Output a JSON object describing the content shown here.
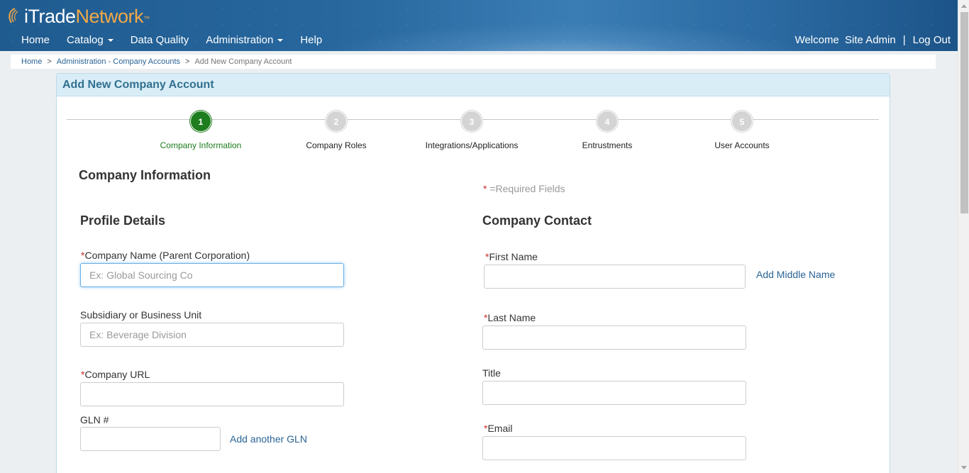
{
  "header": {
    "logo": {
      "i": "i",
      "trade": "Trade",
      "network": "Network",
      "tm": "™"
    },
    "nav": [
      {
        "label": "Home",
        "dropdown": false
      },
      {
        "label": "Catalog",
        "dropdown": true
      },
      {
        "label": "Data Quality",
        "dropdown": false
      },
      {
        "label": "Administration",
        "dropdown": true
      },
      {
        "label": "Help",
        "dropdown": false
      }
    ],
    "welcome": "Welcome",
    "user_name": "Site Admin",
    "separator": "|",
    "logout": "Log Out"
  },
  "breadcrumb": {
    "items": [
      "Home",
      "Administration - Company Accounts"
    ],
    "separator": ">",
    "current": "Add New Company Account"
  },
  "panel": {
    "title": "Add New Company Account"
  },
  "steps": [
    {
      "number": "1",
      "label": "Company Information",
      "active": true
    },
    {
      "number": "2",
      "label": "Company Roles",
      "active": false
    },
    {
      "number": "3",
      "label": "Integrations/Applications",
      "active": false
    },
    {
      "number": "4",
      "label": "Entrustments",
      "active": false
    },
    {
      "number": "5",
      "label": "User Accounts",
      "active": false
    }
  ],
  "form": {
    "section_title": "Company Information",
    "required_star": "*",
    "required_note": " =Required Fields",
    "profile": {
      "title": "Profile Details",
      "company_name": {
        "label": "Company Name (Parent Corporation)",
        "required": true,
        "value": "",
        "placeholder": "Ex: Global Sourcing Co"
      },
      "subsidiary": {
        "label": "Subsidiary or Business Unit",
        "required": false,
        "value": "",
        "placeholder": "Ex: Beverage Division"
      },
      "company_url": {
        "label": "Company URL",
        "required": true,
        "value": "",
        "placeholder": ""
      },
      "gln": {
        "label": "GLN #",
        "required": false,
        "value": "",
        "placeholder": ""
      },
      "add_gln": "Add another GLN"
    },
    "contact": {
      "title": "Company Contact",
      "first_name": {
        "label": "First Name",
        "required": true,
        "value": "",
        "placeholder": ""
      },
      "add_middle_name": "Add Middle Name",
      "last_name": {
        "label": "Last Name",
        "required": true,
        "value": "",
        "placeholder": ""
      },
      "title_field": {
        "label": "Title",
        "required": false,
        "value": "",
        "placeholder": ""
      },
      "email": {
        "label": "Email",
        "required": true,
        "value": "",
        "placeholder": ""
      }
    }
  },
  "colors": {
    "header_bg": "#27679e",
    "brand_orange": "#f0a848",
    "link": "#2a6496",
    "panel_heading_bg": "#d9edf7",
    "panel_heading_text": "#31708f",
    "step_active": "#1e7d1e",
    "step_inactive": "#d4d4d4",
    "required": "#c9302c"
  }
}
